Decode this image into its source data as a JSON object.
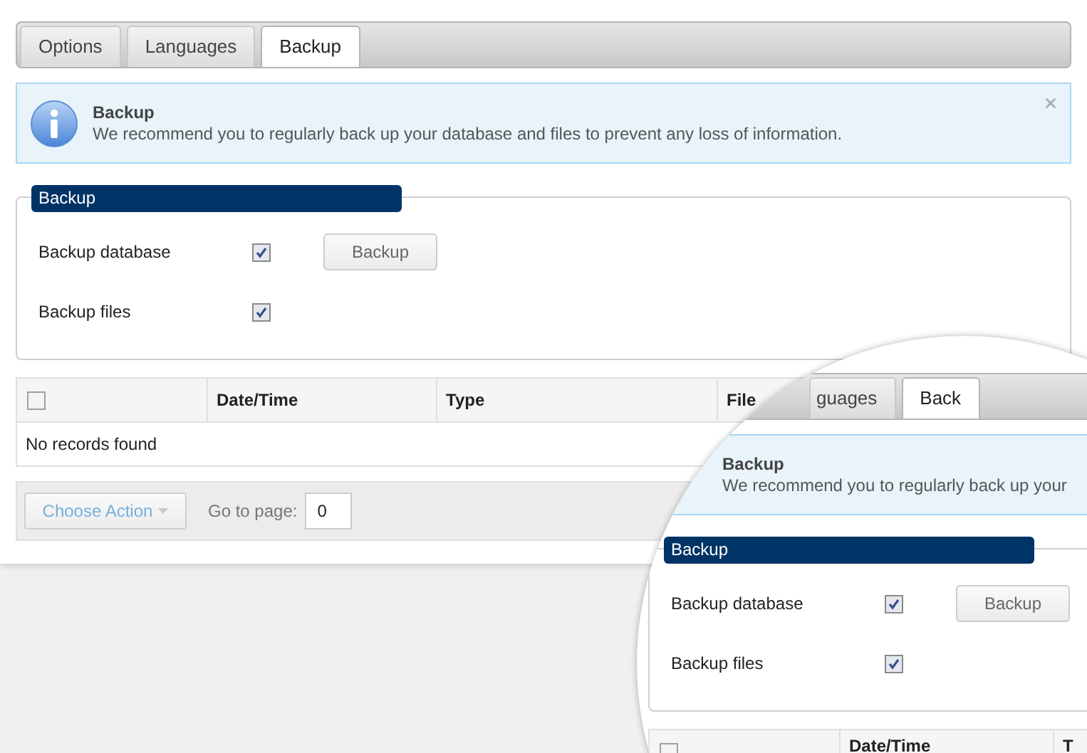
{
  "tabs": [
    {
      "label": "Options",
      "selected": false
    },
    {
      "label": "Languages",
      "selected": false
    },
    {
      "label": "Backup",
      "selected": true
    }
  ],
  "alert": {
    "title": "Backup",
    "message": "We recommend you to regularly back up your database and files to prevent any loss of information."
  },
  "backup_panel": {
    "legend": "Backup",
    "button": "Backup",
    "options": [
      {
        "label": "Backup database",
        "checked": true
      },
      {
        "label": "Backup files",
        "checked": true
      }
    ]
  },
  "table": {
    "select_all_checked": false,
    "columns": [
      "Date/Time",
      "Type",
      "File"
    ],
    "empty_message": "No records found"
  },
  "footer": {
    "action": "Choose Action",
    "goto_label": "Go to page:",
    "page_value": "0"
  },
  "magnifier": {
    "tabs": [
      {
        "label": "guages",
        "selected": false
      },
      {
        "label": "Back",
        "selected": true
      }
    ],
    "alert": {
      "title": "Backup",
      "message": "We recommend you to regularly back up your"
    },
    "backup_panel": {
      "legend": "Backup",
      "button": "Backup",
      "options": [
        {
          "label": "Backup database",
          "checked": true
        },
        {
          "label": "Backup files",
          "checked": true
        }
      ]
    },
    "table": {
      "select_all_checked": false,
      "columns": [
        "Date/Time",
        "T"
      ]
    }
  }
}
